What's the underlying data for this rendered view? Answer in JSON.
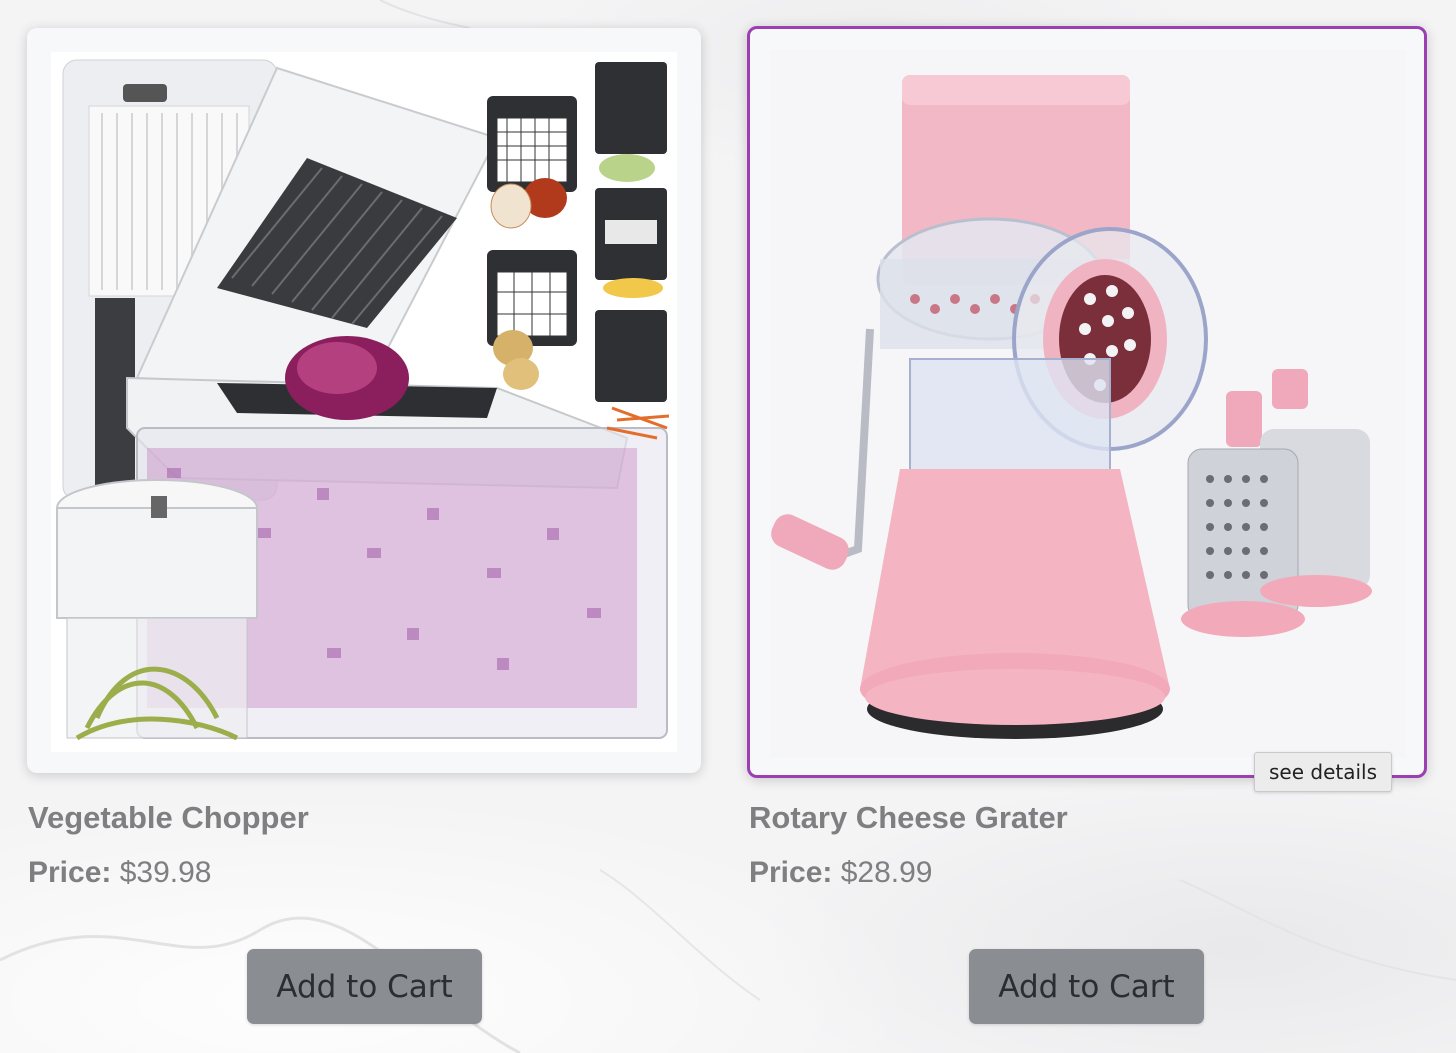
{
  "products": [
    {
      "name": "Vegetable Chopper",
      "price_label": "Price:",
      "price": "$39.98",
      "add_to_cart": "Add to Cart"
    },
    {
      "name": "Rotary Cheese Grater",
      "price_label": "Price:",
      "price": "$28.99",
      "add_to_cart": "Add to Cart",
      "tooltip": "see details"
    }
  ],
  "colors": {
    "selected_border": "#9b3fb3",
    "button_bg": "#8a8e93",
    "text_muted": "#7f7f82"
  }
}
